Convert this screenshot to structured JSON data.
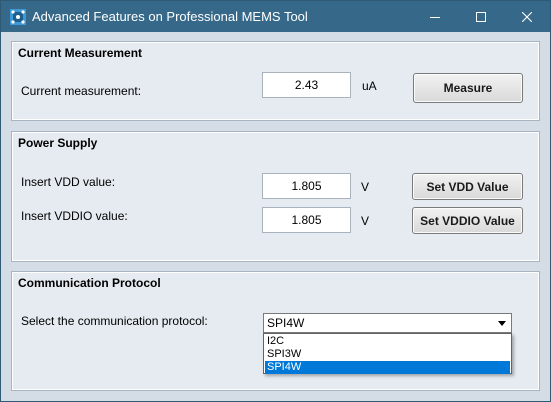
{
  "window": {
    "title": "Advanced Features on Professional MEMS Tool",
    "icons": {
      "app": "mems-app-icon",
      "minimize": "minimize-icon",
      "maximize": "maximize-icon",
      "close": "close-icon"
    },
    "colors": {
      "titlebar": "#366989",
      "client": "#d4dde6",
      "group": "#e5ebf1",
      "selection": "#0078d7"
    }
  },
  "current_measurement": {
    "title": "Current Measurement",
    "label": "Current measurement:",
    "value": "2.43",
    "unit": "uA",
    "button_label": "Measure"
  },
  "power_supply": {
    "title": "Power Supply",
    "vdd": {
      "label": "Insert VDD value:",
      "value": "1.805",
      "unit": "V",
      "button_label": "Set VDD Value"
    },
    "vddio": {
      "label": "Insert VDDIO value:",
      "value": "1.805",
      "unit": "V",
      "button_label": "Set VDDIO Value"
    }
  },
  "communication_protocol": {
    "title": "Communication Protocol",
    "label": "Select the communication protocol:",
    "selected": "SPI4W",
    "options": [
      "I2C",
      "SPI3W",
      "SPI4W"
    ],
    "highlighted_option": "SPI4W"
  }
}
